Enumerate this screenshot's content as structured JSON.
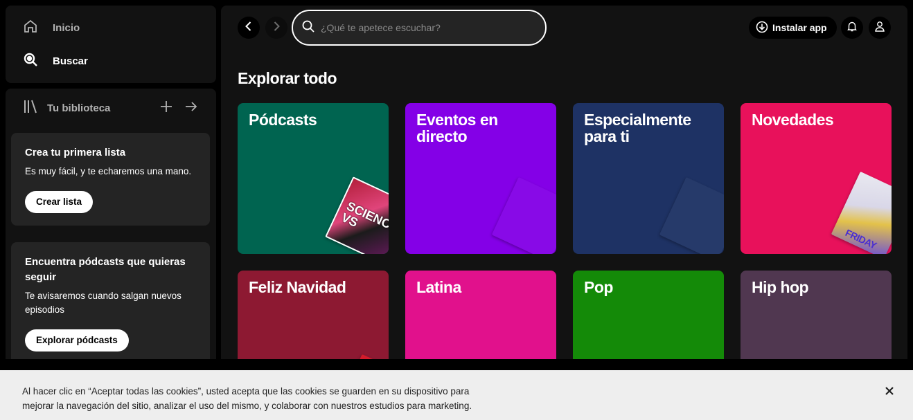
{
  "nav": {
    "home_label": "Inicio",
    "search_label": "Buscar"
  },
  "library": {
    "title": "Tu biblioteca",
    "cards": [
      {
        "title": "Crea tu primera lista",
        "text": "Es muy fácil, y te echaremos una mano.",
        "button": "Crear lista"
      },
      {
        "title": "Encuentra pódcasts que quieras seguir",
        "text": "Te avisaremos cuando salgan nuevos episodios",
        "button": "Explorar pódcasts"
      }
    ]
  },
  "header": {
    "search_placeholder": "¿Qué te apetece escuchar?",
    "install_label": "Instalar app"
  },
  "browse": {
    "title": "Explorar todo",
    "tiles": [
      {
        "label": "Pódcasts",
        "color": "#006450"
      },
      {
        "label": "Eventos en directo",
        "color": "#8400e7"
      },
      {
        "label": "Especialmente para ti",
        "color": "#1e3264"
      },
      {
        "label": "Novedades",
        "color": "#e8115b"
      },
      {
        "label": "Feliz Navidad",
        "color": "#8d1932"
      },
      {
        "label": "Latina",
        "color": "#e1118c"
      },
      {
        "label": "Pop",
        "color": "#148a08"
      },
      {
        "label": "Hip hop",
        "color": "#503750"
      }
    ],
    "art": {
      "podcasts_cover_text": "SCIENCE VS",
      "novedades_cover_text": "FRIDAY"
    }
  },
  "cookie": {
    "text_line1": "Al hacer clic en “Aceptar todas las cookies”, usted acepta que las cookies se guarden en su dispositivo para",
    "text_line2": "mejorar la navegación del sitio, analizar el uso del mismo, y colaborar con nuestros estudios para marketing."
  },
  "colors": {
    "background": "#000000",
    "panel": "#121212",
    "card": "#242424",
    "cookie_bar": "#eeeeee"
  }
}
